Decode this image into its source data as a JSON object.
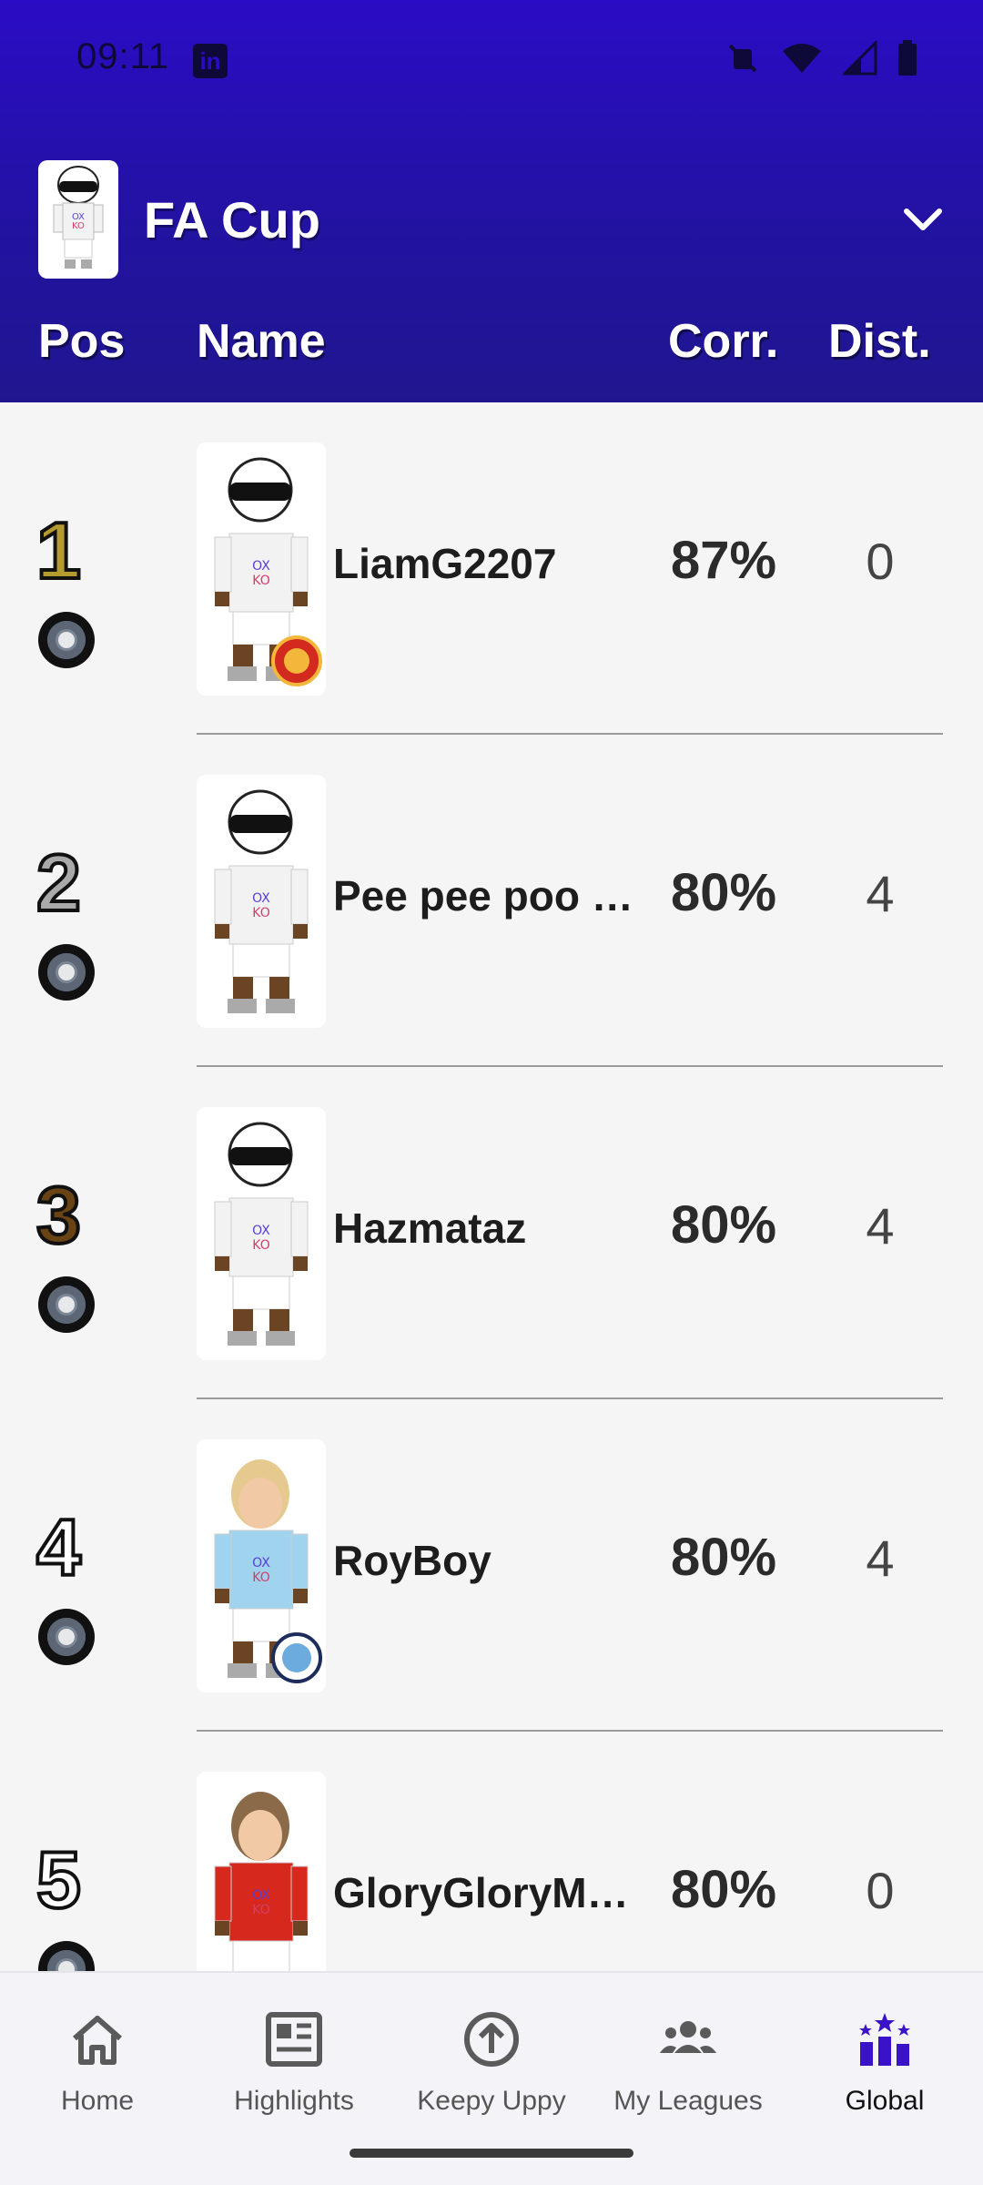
{
  "status_bar": {
    "time": "09:11"
  },
  "header": {
    "league_name": "FA Cup",
    "columns": {
      "pos": "Pos",
      "name": "Name",
      "corr": "Corr.",
      "dist": "Dist."
    }
  },
  "rows": [
    {
      "position": "1",
      "name": "LiamG2207",
      "corr": "87%",
      "dist": "0",
      "pos_color": "#b59b2f",
      "badge": "manchester-united-badge"
    },
    {
      "position": "2",
      "name": "Pee pee poo …",
      "corr": "80%",
      "dist": "4",
      "pos_color": "#a9a9a9",
      "badge": ""
    },
    {
      "position": "3",
      "name": "Hazmataz",
      "corr": "80%",
      "dist": "4",
      "pos_color": "#6a4314",
      "badge": ""
    },
    {
      "position": "4",
      "name": "RoyBoy",
      "corr": "80%",
      "dist": "4",
      "pos_color": "#ffffff",
      "badge": "manchester-city-badge"
    },
    {
      "position": "5",
      "name": "GloryGloryM…",
      "corr": "80%",
      "dist": "0",
      "pos_color": "#ffffff",
      "badge": ""
    }
  ],
  "nav": [
    {
      "label": "Home",
      "icon": "home-icon",
      "active": false
    },
    {
      "label": "Highlights",
      "icon": "highlights-icon",
      "active": false
    },
    {
      "label": "Keepy Uppy",
      "icon": "keepy-uppy-icon",
      "active": false
    },
    {
      "label": "My Leagues",
      "icon": "my-leagues-icon",
      "active": false
    },
    {
      "label": "Global",
      "icon": "global-icon",
      "active": true
    }
  ],
  "colors": {
    "header": "#2a0cc4",
    "accent": "#3a13c9",
    "background": "#f5f5f6"
  }
}
